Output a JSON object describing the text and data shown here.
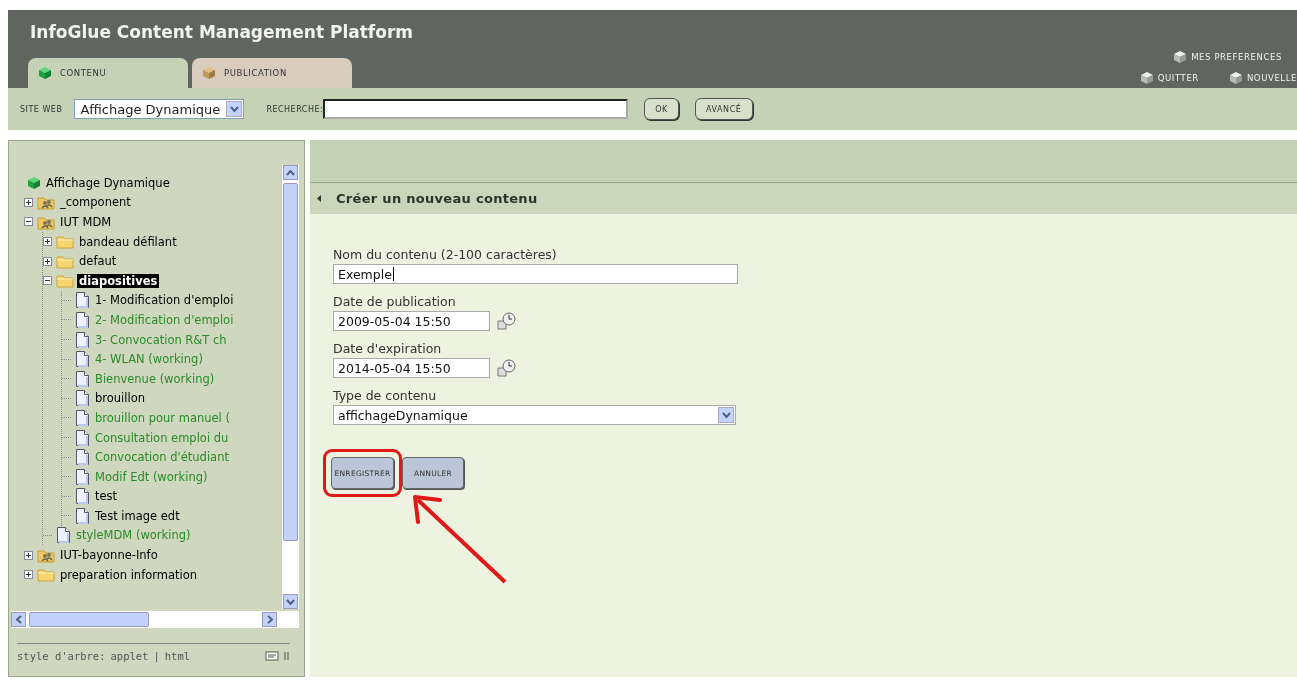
{
  "header": {
    "title": "InfoGlue Content Management Platform",
    "links": [
      {
        "label": "MES PREFERENCES"
      },
      {
        "label": "QUITTER"
      },
      {
        "label": "NOUVELLE"
      }
    ]
  },
  "tabs": [
    {
      "label": "CONTENU",
      "kind": "content",
      "selected": true
    },
    {
      "label": "PUBLICATION",
      "kind": "publish",
      "selected": false
    }
  ],
  "toolbar": {
    "site_label": "SITE WEB",
    "site_value": "Affichage Dynamique",
    "search_label": "RECHERCHE:",
    "buttons": [
      "OK",
      "AVANCÉ"
    ]
  },
  "tree": {
    "nodes": [
      {
        "label": "Affichage Dynamique",
        "kind": "site",
        "selected": false,
        "color": "#000000",
        "children": [
          {
            "label": "_component",
            "kind": "repository",
            "expanded": false,
            "selected": false,
            "color": "#000000"
          },
          {
            "label": "IUT MDM",
            "kind": "repository",
            "expanded": true,
            "selected": false,
            "color": "#000000",
            "children": [
              {
                "label": "bandeau défilant",
                "kind": "folder",
                "expanded": false,
                "selected": false,
                "color": "#000000"
              },
              {
                "label": "defaut",
                "kind": "folder",
                "expanded": false,
                "selected": false,
                "color": "#000000"
              },
              {
                "label": "diapositives",
                "kind": "folder",
                "expanded": true,
                "selected": true,
                "color": "#000000",
                "children": [
                  {
                    "label": "1- Modification d'emploi",
                    "kind": "document",
                    "selected": false,
                    "color": "#000000"
                  },
                  {
                    "label": "2- Modification d'emploi",
                    "kind": "document",
                    "selected": false,
                    "color": "#2a8a2a"
                  },
                  {
                    "label": "3- Convocation R&T ch",
                    "kind": "document",
                    "selected": false,
                    "color": "#2a8a2a"
                  },
                  {
                    "label": "4- WLAN (working)",
                    "kind": "document",
                    "selected": false,
                    "color": "#2a8a2a"
                  },
                  {
                    "label": "Bienvenue (working)",
                    "kind": "document",
                    "selected": false,
                    "color": "#2a8a2a"
                  },
                  {
                    "label": "brouillon",
                    "kind": "document",
                    "selected": false,
                    "color": "#000000"
                  },
                  {
                    "label": "brouillon pour manuel (",
                    "kind": "document",
                    "selected": false,
                    "color": "#2a8a2a"
                  },
                  {
                    "label": "Consultation emploi du",
                    "kind": "document",
                    "selected": false,
                    "color": "#2a8a2a"
                  },
                  {
                    "label": "Convocation d'étudiant",
                    "kind": "document",
                    "selected": false,
                    "color": "#2a8a2a"
                  },
                  {
                    "label": "Modif Edt (working)",
                    "kind": "document",
                    "selected": false,
                    "color": "#2a8a2a"
                  },
                  {
                    "label": "test",
                    "kind": "document",
                    "selected": false,
                    "color": "#000000"
                  },
                  {
                    "label": "Test image edt",
                    "kind": "document",
                    "selected": false,
                    "color": "#000000"
                  }
                ]
              },
              {
                "label": "styleMDM (working)",
                "kind": "document",
                "selected": false,
                "color": "#2a8a2a"
              }
            ]
          },
          {
            "label": "IUT-bayonne-Info",
            "kind": "repository",
            "expanded": false,
            "selected": false,
            "color": "#000000"
          },
          {
            "label": "preparation information",
            "kind": "folder",
            "expanded": false,
            "selected": false,
            "color": "#000000"
          }
        ]
      }
    ],
    "footer": {
      "label": "style d'arbre:",
      "links": [
        "applet",
        "html"
      ],
      "separator": "|"
    }
  },
  "form": {
    "title": "Créer un nouveau contenu",
    "fields": [
      {
        "kind": "text",
        "label": "Nom du contenu (2-100 caractères)",
        "value": "Exemple"
      },
      {
        "kind": "date",
        "label": "Date de publication",
        "value": "2009-05-04 15:50"
      },
      {
        "kind": "date",
        "label": "Date d'expiration",
        "value": "2014-05-04 15:50"
      },
      {
        "kind": "select",
        "label": "Type de contenu",
        "value": "affichageDynamique"
      }
    ],
    "buttons": [
      {
        "label": "ENREGISTRER",
        "highlighted": true
      },
      {
        "label": "ANNULER",
        "highlighted": false
      }
    ]
  }
}
